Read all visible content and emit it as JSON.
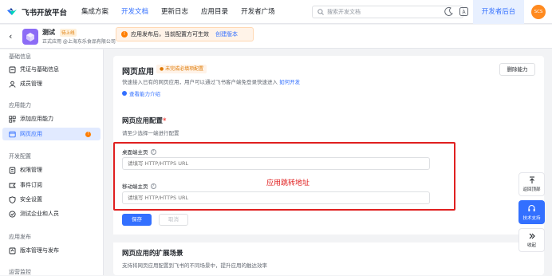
{
  "topbar": {
    "logo_text": "飞书开放平台",
    "nav": [
      "集成方案",
      "开发文档",
      "更新日志",
      "应用目录",
      "开发者广场"
    ],
    "active_nav": 1,
    "search_placeholder": "搜索开发文档",
    "dev_console": "开发者后台",
    "avatar_text": "SCS",
    "brand_color": "#3370ff"
  },
  "appbar": {
    "app_name": "测试",
    "app_tag": "待上线",
    "app_sub": "正式应用 @上海东乐食品有限公司",
    "notice_text": "应用发布后，当前配置方可生效",
    "notice_link": "创建版本"
  },
  "sidebar": {
    "sections": [
      {
        "title": "基础信息",
        "items": [
          "凭证与基础信息",
          "成员管理"
        ]
      },
      {
        "title": "应用能力",
        "items": [
          "添加应用能力",
          "网页应用"
        ]
      },
      {
        "title": "开发配置",
        "items": [
          "权限管理",
          "事件订阅",
          "安全设置",
          "测试企业和人员"
        ]
      },
      {
        "title": "应用发布",
        "items": [
          "版本管理与发布"
        ]
      },
      {
        "title": "运营监控",
        "items": []
      }
    ],
    "active_item": "网页应用",
    "badge": "!"
  },
  "main": {
    "title": "网页应用",
    "status_badge": "未完成必填项配置",
    "description": "快速接入已有的网页应用，用户可以通过飞书客户端免登录快速进入",
    "desc_link": "如何开发",
    "intro_link": "查看能力介绍",
    "delete_button": "删除能力",
    "config_title": "网页应用配置",
    "required_mark": "*",
    "config_sub": "请至少选择一端进行配置",
    "desktop_label": "桌面端主页",
    "desktop_placeholder": "请填写 HTTP/HTTPS URL",
    "mobile_label": "移动端主页",
    "mobile_placeholder": "请填写 HTTP/HTTPS URL",
    "annotation": "应用跳转地址",
    "save": "保存",
    "cancel": "取消",
    "ext_title": "网页应用的扩展场景",
    "ext_sub": "支持将网页应用配置到飞书的不同场景中，提升应用的触达效率"
  },
  "float": {
    "top": "返回顶部",
    "support": "技术支持",
    "collapse": "收起"
  }
}
